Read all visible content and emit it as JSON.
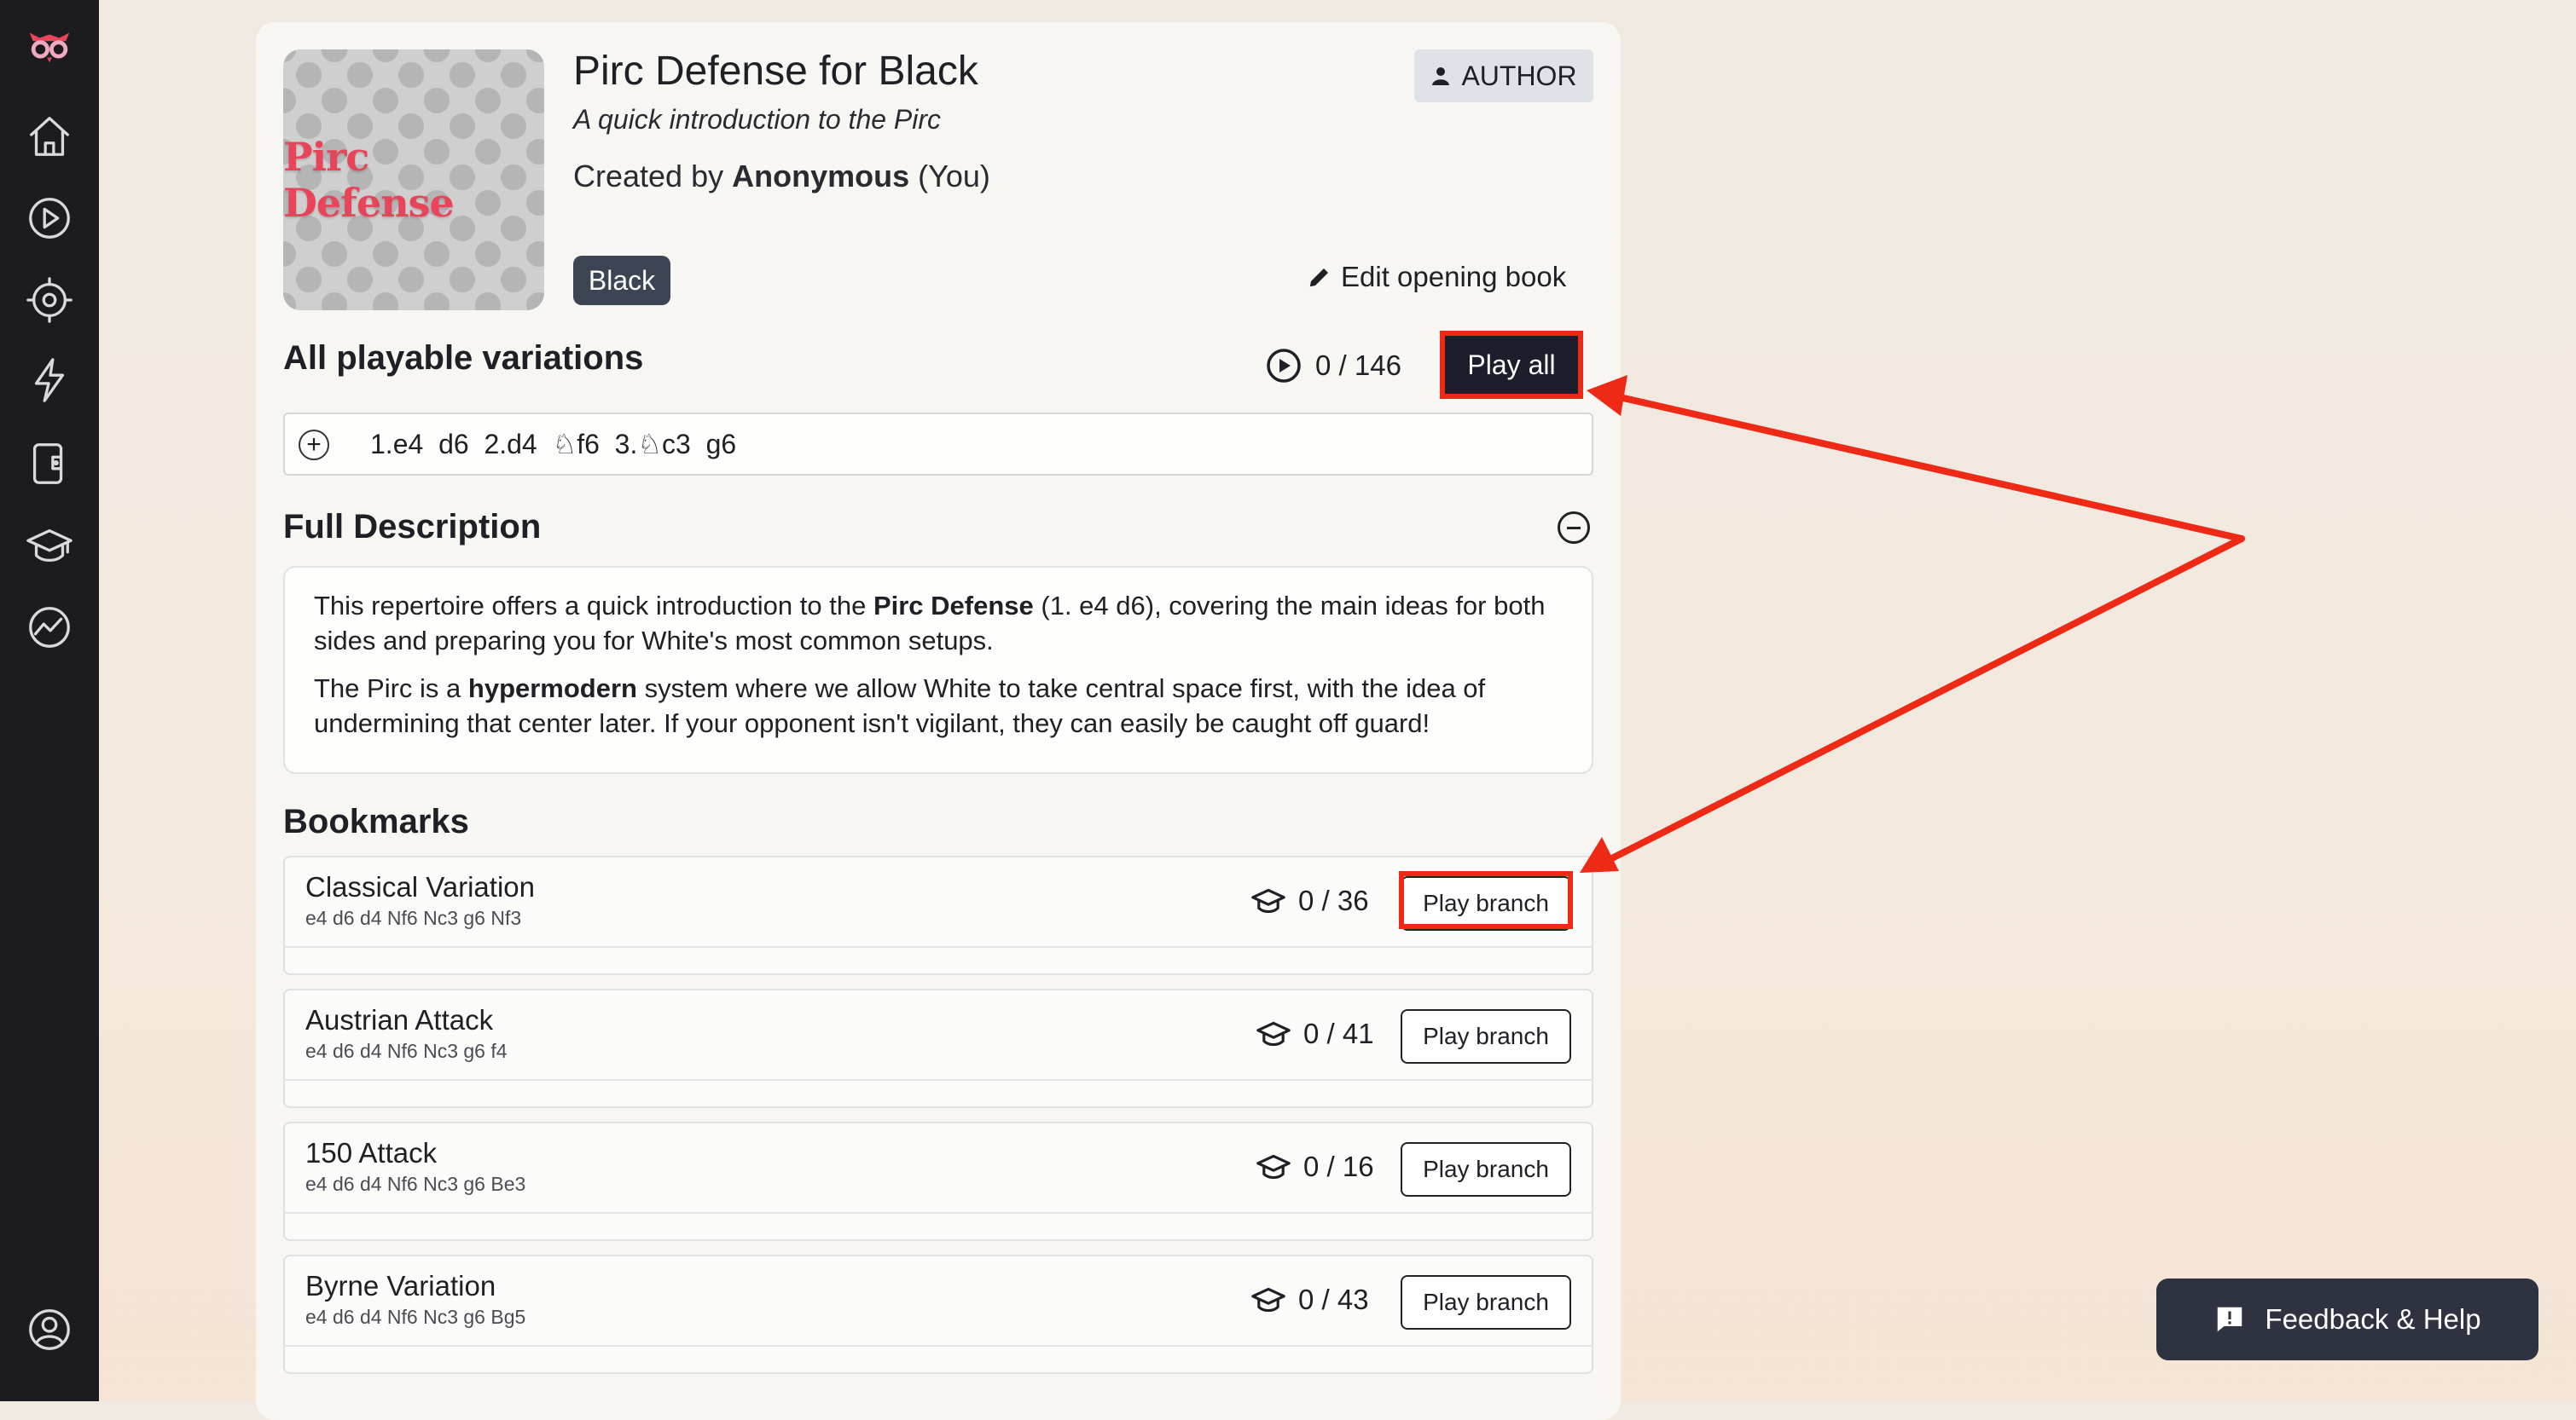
{
  "sidebar": {
    "items": [
      {
        "icon": "owl-logo-icon"
      },
      {
        "icon": "home-icon"
      },
      {
        "icon": "play-icon"
      },
      {
        "icon": "target-icon"
      },
      {
        "icon": "lightning-icon"
      },
      {
        "icon": "book-icon"
      },
      {
        "icon": "graduation-cap-icon"
      },
      {
        "icon": "chart-icon"
      }
    ],
    "profile_icon": "user-circle-icon"
  },
  "book": {
    "cover_text": "Pirc Defense",
    "title": "Pirc Defense for Black",
    "subtitle": "A quick introduction to the Pirc",
    "created_prefix": "Created by",
    "creator": "Anonymous",
    "creator_suffix": "(You)",
    "author_label": "AUTHOR",
    "color_tag": "Black",
    "edit_label": "Edit opening book"
  },
  "variations": {
    "heading": "All playable variations",
    "progress": "0 / 146",
    "play_all_label": "Play all",
    "line": {
      "m1": "1.e4",
      "m2": "d6",
      "m3": "2.d4",
      "m4": "f6",
      "m5": "3.",
      "m6": "c3",
      "m7": "g6"
    }
  },
  "description": {
    "heading": "Full Description",
    "p1_a": "This repertoire offers a quick introduction to the ",
    "p1_b": "Pirc Defense",
    "p1_c": " (1. e4 d6), covering the main ideas for both sides and preparing you for White's most common setups.",
    "p2_a": "The Pirc is a ",
    "p2_b": "hypermodern",
    "p2_c": " system where we allow White to take central space first, with the idea of undermining that center later. If your opponent isn't vigilant, they can easily be caught off guard!"
  },
  "bookmarks": {
    "heading": "Bookmarks",
    "items": [
      {
        "name": "Classical Variation",
        "moves": "e4 d6 d4 Nf6 Nc3 g6 Nf3",
        "progress": "0 / 36",
        "button": "Play branch"
      },
      {
        "name": "Austrian Attack",
        "moves": "e4 d6 d4 Nf6 Nc3 g6 f4",
        "progress": "0 / 41",
        "button": "Play branch"
      },
      {
        "name": "150 Attack",
        "moves": "e4 d6 d4 Nf6 Nc3 g6 Be3",
        "progress": "0 / 16",
        "button": "Play branch"
      },
      {
        "name": "Byrne Variation",
        "moves": "e4 d6 d4 Nf6 Nc3 g6 Bg5",
        "progress": "0 / 43",
        "button": "Play branch"
      }
    ]
  },
  "feedback": {
    "label": "Feedback & Help"
  },
  "colors": {
    "annotation": "#ee2a16",
    "sidebar": "#1c1c20",
    "primary_button": "#1c1f2b",
    "tag": "#3d4554"
  }
}
